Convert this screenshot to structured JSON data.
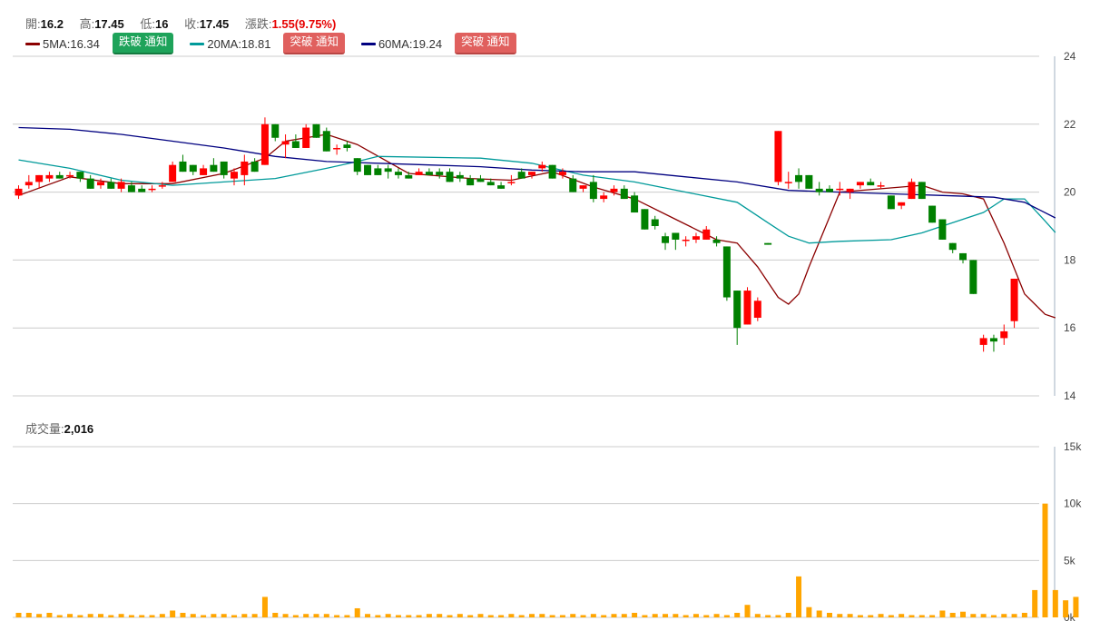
{
  "header": {
    "open_label": "開:",
    "open": "16.2",
    "high_label": "高:",
    "high": "17.45",
    "low_label": "低:",
    "low": "16",
    "close_label": "收:",
    "close": "17.45",
    "change_label": "漲跌:",
    "change": "1.55(9.75%)"
  },
  "ma_legend": [
    {
      "label": "5MA:16.34",
      "color": "#8b0000",
      "button": "跌破 通知",
      "button_kind": "down"
    },
    {
      "label": "20MA:18.81",
      "color": "#009a9a",
      "button": "突破 通知",
      "button_kind": "up"
    },
    {
      "label": "60MA:19.24",
      "color": "#000080",
      "button": "突破 通知",
      "button_kind": "up"
    }
  ],
  "volume_header": {
    "label": "成交量:",
    "value": "2,016"
  },
  "colors": {
    "up": "#ff0000",
    "down": "#008000",
    "volume": "#ffa500",
    "grid": "#cccccc"
  },
  "chart_data": [
    {
      "type": "candlestick",
      "ylim": [
        14,
        24
      ],
      "yticks": [
        "24",
        "22",
        "20",
        "18",
        "16",
        "14"
      ],
      "candles": [
        {
          "o": 19.9,
          "h": 20.2,
          "l": 19.8,
          "c": 20.1
        },
        {
          "o": 20.2,
          "h": 20.5,
          "l": 20.1,
          "c": 20.3
        },
        {
          "o": 20.3,
          "h": 20.5,
          "l": 20.1,
          "c": 20.5
        },
        {
          "o": 20.4,
          "h": 20.6,
          "l": 20.3,
          "c": 20.5
        },
        {
          "o": 20.5,
          "h": 20.6,
          "l": 20.4,
          "c": 20.4
        },
        {
          "o": 20.5,
          "h": 20.6,
          "l": 20.4,
          "c": 20.5
        },
        {
          "o": 20.6,
          "h": 20.6,
          "l": 20.3,
          "c": 20.4
        },
        {
          "o": 20.4,
          "h": 20.5,
          "l": 20.1,
          "c": 20.1
        },
        {
          "o": 20.2,
          "h": 20.4,
          "l": 20.1,
          "c": 20.3
        },
        {
          "o": 20.3,
          "h": 20.4,
          "l": 20.1,
          "c": 20.1
        },
        {
          "o": 20.1,
          "h": 20.4,
          "l": 20.0,
          "c": 20.3
        },
        {
          "o": 20.2,
          "h": 20.3,
          "l": 20.0,
          "c": 20.0
        },
        {
          "o": 20.1,
          "h": 20.2,
          "l": 20.0,
          "c": 20.0
        },
        {
          "o": 20.1,
          "h": 20.2,
          "l": 20.0,
          "c": 20.1
        },
        {
          "o": 20.2,
          "h": 20.3,
          "l": 20.1,
          "c": 20.2
        },
        {
          "o": 20.3,
          "h": 20.9,
          "l": 20.3,
          "c": 20.8
        },
        {
          "o": 20.9,
          "h": 21.1,
          "l": 20.6,
          "c": 20.6
        },
        {
          "o": 20.8,
          "h": 20.8,
          "l": 20.5,
          "c": 20.6
        },
        {
          "o": 20.5,
          "h": 20.8,
          "l": 20.5,
          "c": 20.7
        },
        {
          "o": 20.8,
          "h": 21.0,
          "l": 20.6,
          "c": 20.6
        },
        {
          "o": 20.9,
          "h": 20.9,
          "l": 20.4,
          "c": 20.5
        },
        {
          "o": 20.4,
          "h": 20.7,
          "l": 20.2,
          "c": 20.6
        },
        {
          "o": 20.5,
          "h": 21.1,
          "l": 20.2,
          "c": 20.9
        },
        {
          "o": 20.9,
          "h": 21.0,
          "l": 20.6,
          "c": 20.6
        },
        {
          "o": 20.8,
          "h": 22.2,
          "l": 20.8,
          "c": 22.0
        },
        {
          "o": 22.0,
          "h": 22.0,
          "l": 21.5,
          "c": 21.6
        },
        {
          "o": 21.4,
          "h": 21.7,
          "l": 21.0,
          "c": 21.5
        },
        {
          "o": 21.5,
          "h": 21.7,
          "l": 21.3,
          "c": 21.3
        },
        {
          "o": 21.3,
          "h": 22.0,
          "l": 21.3,
          "c": 21.9
        },
        {
          "o": 22.0,
          "h": 22.0,
          "l": 21.6,
          "c": 21.6
        },
        {
          "o": 21.8,
          "h": 21.9,
          "l": 21.2,
          "c": 21.2
        },
        {
          "o": 21.3,
          "h": 21.4,
          "l": 21.1,
          "c": 21.3
        },
        {
          "o": 21.4,
          "h": 21.5,
          "l": 21.2,
          "c": 21.3
        },
        {
          "o": 21.0,
          "h": 21.0,
          "l": 20.5,
          "c": 20.6
        },
        {
          "o": 20.8,
          "h": 20.8,
          "l": 20.5,
          "c": 20.5
        },
        {
          "o": 20.7,
          "h": 20.8,
          "l": 20.5,
          "c": 20.5
        },
        {
          "o": 20.7,
          "h": 20.8,
          "l": 20.4,
          "c": 20.6
        },
        {
          "o": 20.6,
          "h": 20.7,
          "l": 20.4,
          "c": 20.5
        },
        {
          "o": 20.5,
          "h": 20.6,
          "l": 20.4,
          "c": 20.4
        },
        {
          "o": 20.5,
          "h": 20.7,
          "l": 20.5,
          "c": 20.6
        },
        {
          "o": 20.6,
          "h": 20.7,
          "l": 20.5,
          "c": 20.5
        },
        {
          "o": 20.6,
          "h": 20.7,
          "l": 20.4,
          "c": 20.5
        },
        {
          "o": 20.6,
          "h": 20.7,
          "l": 20.3,
          "c": 20.3
        },
        {
          "o": 20.5,
          "h": 20.6,
          "l": 20.3,
          "c": 20.4
        },
        {
          "o": 20.4,
          "h": 20.5,
          "l": 20.2,
          "c": 20.2
        },
        {
          "o": 20.4,
          "h": 20.5,
          "l": 20.3,
          "c": 20.3
        },
        {
          "o": 20.3,
          "h": 20.4,
          "l": 20.2,
          "c": 20.2
        },
        {
          "o": 20.2,
          "h": 20.3,
          "l": 20.1,
          "c": 20.1
        },
        {
          "o": 20.3,
          "h": 20.5,
          "l": 20.2,
          "c": 20.3
        },
        {
          "o": 20.6,
          "h": 20.7,
          "l": 20.4,
          "c": 20.4
        },
        {
          "o": 20.5,
          "h": 20.6,
          "l": 20.4,
          "c": 20.6
        },
        {
          "o": 20.7,
          "h": 20.9,
          "l": 20.6,
          "c": 20.8
        },
        {
          "o": 20.8,
          "h": 20.8,
          "l": 20.4,
          "c": 20.4
        },
        {
          "o": 20.5,
          "h": 20.7,
          "l": 20.4,
          "c": 20.6
        },
        {
          "o": 20.4,
          "h": 20.5,
          "l": 20.0,
          "c": 20.0
        },
        {
          "o": 20.1,
          "h": 20.2,
          "l": 20.0,
          "c": 20.2
        },
        {
          "o": 20.3,
          "h": 20.5,
          "l": 19.7,
          "c": 19.8
        },
        {
          "o": 19.8,
          "h": 20.0,
          "l": 19.7,
          "c": 19.9
        },
        {
          "o": 20.0,
          "h": 20.2,
          "l": 19.9,
          "c": 20.1
        },
        {
          "o": 20.1,
          "h": 20.2,
          "l": 19.8,
          "c": 19.8
        },
        {
          "o": 19.9,
          "h": 20.0,
          "l": 19.4,
          "c": 19.4
        },
        {
          "o": 19.5,
          "h": 19.5,
          "l": 18.9,
          "c": 18.9
        },
        {
          "o": 19.2,
          "h": 19.3,
          "l": 18.9,
          "c": 19.0
        },
        {
          "o": 18.7,
          "h": 18.8,
          "l": 18.3,
          "c": 18.5
        },
        {
          "o": 18.8,
          "h": 18.8,
          "l": 18.3,
          "c": 18.6
        },
        {
          "o": 18.6,
          "h": 18.7,
          "l": 18.4,
          "c": 18.6
        },
        {
          "o": 18.6,
          "h": 18.8,
          "l": 18.5,
          "c": 18.7
        },
        {
          "o": 18.6,
          "h": 19.0,
          "l": 18.6,
          "c": 18.9
        },
        {
          "o": 18.6,
          "h": 18.7,
          "l": 18.4,
          "c": 18.5
        },
        {
          "o": 18.4,
          "h": 18.4,
          "l": 16.8,
          "c": 16.9
        },
        {
          "o": 17.1,
          "h": 17.1,
          "l": 15.5,
          "c": 16.0
        },
        {
          "o": 16.1,
          "h": 17.2,
          "l": 16.1,
          "c": 17.1
        },
        {
          "o": 16.3,
          "h": 16.9,
          "l": 16.2,
          "c": 16.8
        },
        {
          "o": 18.5,
          "h": 18.5,
          "l": 18.45,
          "c": 18.45
        },
        {
          "o": 20.3,
          "h": 21.8,
          "l": 20.2,
          "c": 21.8
        },
        {
          "o": 20.3,
          "h": 20.6,
          "l": 20.1,
          "c": 20.3
        },
        {
          "o": 20.5,
          "h": 20.7,
          "l": 20.1,
          "c": 20.3
        },
        {
          "o": 20.5,
          "h": 20.5,
          "l": 20.1,
          "c": 20.1
        },
        {
          "o": 20.1,
          "h": 20.3,
          "l": 19.9,
          "c": 20.0
        },
        {
          "o": 20.1,
          "h": 20.2,
          "l": 20.0,
          "c": 20.0
        },
        {
          "o": 20.1,
          "h": 20.3,
          "l": 19.9,
          "c": 20.1
        },
        {
          "o": 20.0,
          "h": 20.1,
          "l": 19.8,
          "c": 20.1
        },
        {
          "o": 20.2,
          "h": 20.3,
          "l": 20.1,
          "c": 20.3
        },
        {
          "o": 20.3,
          "h": 20.4,
          "l": 20.2,
          "c": 20.2
        },
        {
          "o": 20.2,
          "h": 20.3,
          "l": 20.1,
          "c": 20.2
        },
        {
          "o": 19.9,
          "h": 19.9,
          "l": 19.5,
          "c": 19.5
        },
        {
          "o": 19.6,
          "h": 19.7,
          "l": 19.5,
          "c": 19.7
        },
        {
          "o": 19.8,
          "h": 20.4,
          "l": 19.8,
          "c": 20.3
        },
        {
          "o": 20.3,
          "h": 20.3,
          "l": 19.8,
          "c": 19.8
        },
        {
          "o": 19.6,
          "h": 19.6,
          "l": 19.1,
          "c": 19.1
        },
        {
          "o": 19.2,
          "h": 19.2,
          "l": 18.6,
          "c": 18.6
        },
        {
          "o": 18.5,
          "h": 18.5,
          "l": 18.2,
          "c": 18.3
        },
        {
          "o": 18.2,
          "h": 18.2,
          "l": 17.9,
          "c": 18.0
        },
        {
          "o": 18.0,
          "h": 18.0,
          "l": 17.0,
          "c": 17.0
        },
        {
          "o": 15.5,
          "h": 15.8,
          "l": 15.3,
          "c": 15.7
        },
        {
          "o": 15.7,
          "h": 15.8,
          "l": 15.3,
          "c": 15.6
        },
        {
          "o": 15.7,
          "h": 16.1,
          "l": 15.5,
          "c": 15.9
        },
        {
          "o": 16.2,
          "h": 17.45,
          "l": 16.0,
          "c": 17.45
        }
      ],
      "ma_lines": [
        {
          "name": "5MA",
          "color": "#8b0000",
          "points": [
            [
              0,
              19.9
            ],
            [
              5,
              20.45
            ],
            [
              10,
              20.25
            ],
            [
              15,
              20.25
            ],
            [
              20,
              20.55
            ],
            [
              24,
              21.0
            ],
            [
              26,
              21.5
            ],
            [
              30,
              21.7
            ],
            [
              33,
              21.4
            ],
            [
              38,
              20.55
            ],
            [
              44,
              20.4
            ],
            [
              48,
              20.35
            ],
            [
              52,
              20.6
            ],
            [
              56,
              20.15
            ],
            [
              60,
              19.8
            ],
            [
              64,
              19.2
            ],
            [
              68,
              18.6
            ],
            [
              70,
              18.5
            ],
            [
              72,
              17.8
            ],
            [
              74,
              16.9
            ],
            [
              75,
              16.7
            ],
            [
              76,
              17.0
            ],
            [
              77,
              17.8
            ],
            [
              80,
              20.0
            ],
            [
              84,
              20.1
            ],
            [
              88,
              20.2
            ],
            [
              90,
              20.0
            ],
            [
              92,
              19.95
            ],
            [
              94,
              19.8
            ],
            [
              96,
              18.5
            ],
            [
              98,
              17.0
            ],
            [
              99,
              16.7
            ],
            [
              100,
              16.4
            ],
            [
              101,
              16.3
            ]
          ]
        },
        {
          "name": "20MA",
          "color": "#009a9a",
          "points": [
            [
              0,
              20.95
            ],
            [
              5,
              20.7
            ],
            [
              10,
              20.35
            ],
            [
              15,
              20.2
            ],
            [
              20,
              20.3
            ],
            [
              25,
              20.4
            ],
            [
              30,
              20.7
            ],
            [
              33,
              20.9
            ],
            [
              35,
              21.05
            ],
            [
              45,
              21.0
            ],
            [
              50,
              20.85
            ],
            [
              55,
              20.5
            ],
            [
              60,
              20.3
            ],
            [
              65,
              20.0
            ],
            [
              70,
              19.7
            ],
            [
              73,
              19.1
            ],
            [
              75,
              18.7
            ],
            [
              77,
              18.5
            ],
            [
              80,
              18.55
            ],
            [
              85,
              18.6
            ],
            [
              88,
              18.8
            ],
            [
              91,
              19.1
            ],
            [
              94,
              19.4
            ],
            [
              96,
              19.8
            ],
            [
              98,
              19.8
            ],
            [
              100,
              19.15
            ],
            [
              101,
              18.81
            ]
          ]
        },
        {
          "name": "60MA",
          "color": "#000080",
          "points": [
            [
              0,
              21.9
            ],
            [
              5,
              21.85
            ],
            [
              10,
              21.7
            ],
            [
              15,
              21.5
            ],
            [
              20,
              21.3
            ],
            [
              25,
              21.05
            ],
            [
              30,
              20.9
            ],
            [
              35,
              20.85
            ],
            [
              40,
              20.8
            ],
            [
              45,
              20.75
            ],
            [
              50,
              20.65
            ],
            [
              55,
              20.6
            ],
            [
              60,
              20.6
            ],
            [
              65,
              20.45
            ],
            [
              70,
              20.3
            ],
            [
              75,
              20.05
            ],
            [
              80,
              20.0
            ],
            [
              85,
              19.95
            ],
            [
              90,
              19.9
            ],
            [
              95,
              19.85
            ],
            [
              98,
              19.7
            ],
            [
              101,
              19.24
            ]
          ]
        }
      ]
    },
    {
      "type": "bar",
      "name": "volume",
      "ylim": [
        0,
        15000
      ],
      "yticks": [
        "15k",
        "10k",
        "5k",
        "0k"
      ],
      "values": [
        400,
        400,
        300,
        400,
        200,
        300,
        200,
        300,
        300,
        200,
        300,
        200,
        200,
        200,
        300,
        600,
        400,
        300,
        200,
        300,
        300,
        200,
        300,
        300,
        1800,
        400,
        300,
        200,
        300,
        300,
        300,
        200,
        200,
        800,
        300,
        200,
        300,
        200,
        200,
        200,
        300,
        300,
        200,
        300,
        200,
        300,
        200,
        200,
        300,
        200,
        300,
        300,
        200,
        200,
        300,
        200,
        300,
        200,
        300,
        300,
        400,
        200,
        300,
        300,
        300,
        200,
        300,
        200,
        300,
        200,
        400,
        1100,
        300,
        200,
        200,
        400,
        3600,
        900,
        600,
        400,
        300,
        300,
        200,
        200,
        300,
        200,
        300,
        200,
        200,
        200,
        600,
        400,
        500,
        300,
        300,
        200,
        300,
        300,
        400,
        2400,
        10000,
        2400,
        1500,
        1800
      ]
    }
  ]
}
